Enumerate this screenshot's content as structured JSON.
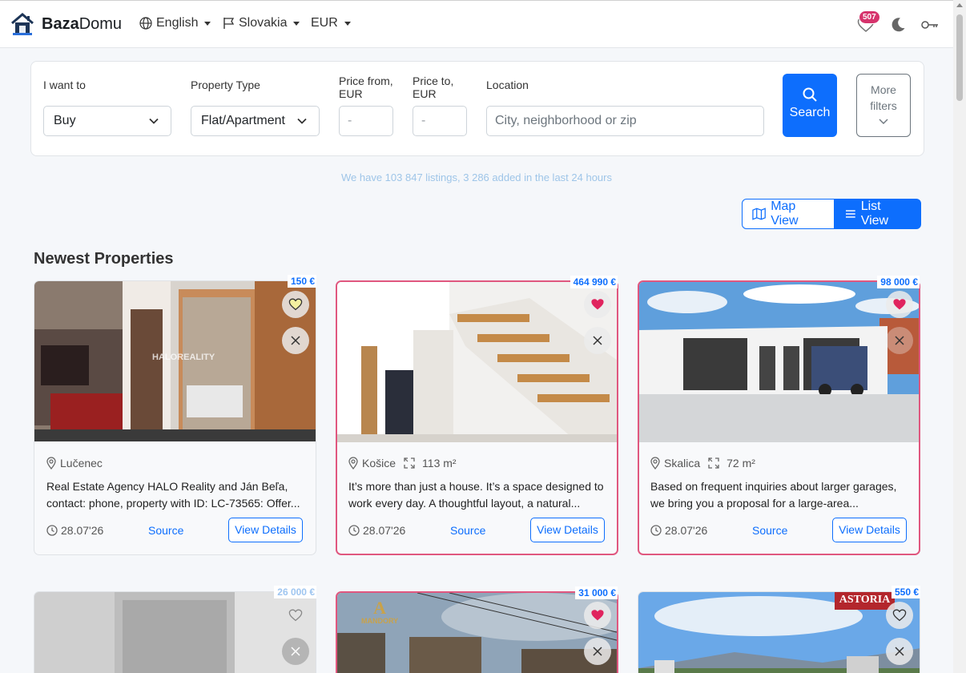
{
  "navbar": {
    "brand_bold": "Baza",
    "brand_light": "Domu",
    "language": "English",
    "country": "Slovakia",
    "currency": "EUR",
    "favorites_count": "507"
  },
  "search": {
    "want_label": "I want to",
    "want_value": "Buy",
    "type_label": "Property Type",
    "type_value": "Flat/Apartment",
    "price_from_label_1": "Price from,",
    "price_from_label_2": "EUR",
    "price_from_placeholder": "-",
    "price_to_label_1": "Price to,",
    "price_to_label_2": "EUR",
    "price_to_placeholder": "-",
    "location_label": "Location",
    "location_placeholder": "City, neighborhood or zip",
    "search_button": "Search",
    "more_filters_1": "More",
    "more_filters_2": "filters"
  },
  "listing_count": "We have 103 847 listings, 3 286 added in the last 24 hours",
  "view_toggle": {
    "map": "Map View",
    "list": "List View"
  },
  "section_title": "Newest Properties",
  "cards": [
    {
      "price": "150 €",
      "location": "Lučenec",
      "area": "",
      "desc": "Real Estate Agency HALO Reality and Ján Beľa, contact: phone, property with ID: LC-73565: Offer...",
      "date": "28.07'26",
      "source": "Source",
      "details": "View Details",
      "watermark": "HALOREALITY"
    },
    {
      "price": "464 990 €",
      "location": "Košice",
      "area": "113 m²",
      "desc": "It’s more than just a house. It’s a space designed to work every day. A thoughtful layout, a natural...",
      "date": "28.07'26",
      "source": "Source",
      "details": "View Details"
    },
    {
      "price": "98 000 €",
      "location": "Skalica",
      "area": "72 m²",
      "desc": "Based on frequent inquiries about larger garages, we bring you a proposal for a large-area...",
      "date": "28.07'26",
      "source": "Source",
      "details": "View Details"
    },
    {
      "price": "26 000 €"
    },
    {
      "price": "31 000 €",
      "logo_text": "MANDORY"
    },
    {
      "price": "550 €",
      "logo_text": "ASTORIA"
    }
  ],
  "colors": {
    "primary": "#0d6efd",
    "favorite": "#e0577f",
    "badge": "#d6336c"
  }
}
